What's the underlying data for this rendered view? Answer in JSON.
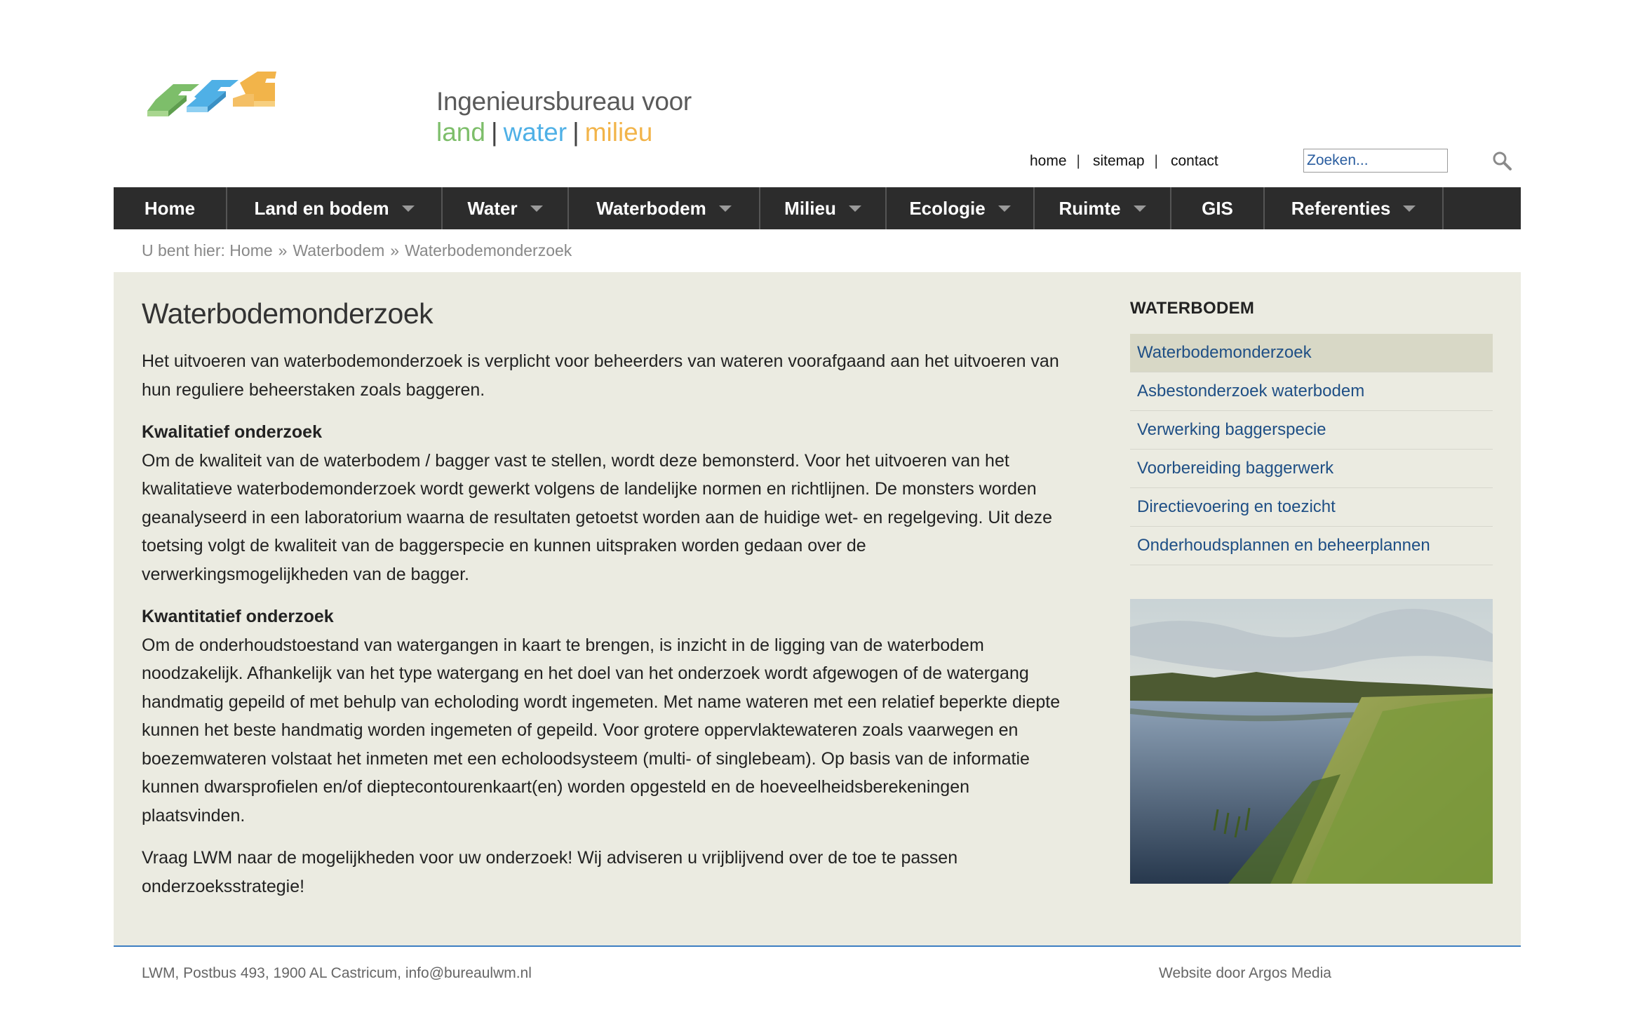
{
  "brand": {
    "title": "Ingenieursbureau voor",
    "sub_land": "land",
    "sub_water": "water",
    "sub_milieu": "milieu",
    "separator": "|",
    "colors": {
      "green": "#7dbe6a",
      "blue": "#4fb0e6",
      "orange": "#f2b44a"
    }
  },
  "topnav": {
    "home": "home",
    "sitemap": "sitemap",
    "contact": "contact",
    "separator": "|"
  },
  "search": {
    "placeholder": "Zoeken...",
    "icon": "search-icon"
  },
  "mainnav": {
    "items": [
      {
        "label": "Home",
        "has_caret": false
      },
      {
        "label": "Land en bodem",
        "has_caret": true
      },
      {
        "label": "Water",
        "has_caret": true
      },
      {
        "label": "Waterbodem",
        "has_caret": true
      },
      {
        "label": "Milieu",
        "has_caret": true
      },
      {
        "label": "Ecologie",
        "has_caret": true
      },
      {
        "label": "Ruimte",
        "has_caret": true
      },
      {
        "label": "GIS",
        "has_caret": false
      },
      {
        "label": "Referenties",
        "has_caret": true
      }
    ]
  },
  "breadcrumb": {
    "prefix": "U bent hier:",
    "items": [
      "Home",
      "Waterbodem",
      "Waterbodemonderzoek"
    ],
    "separator": "»"
  },
  "main": {
    "title": "Waterbodemonderzoek",
    "intro": "Het uitvoeren van waterbodemonderzoek is verplicht voor beheerders van wateren voorafgaand aan het uitvoeren van hun reguliere beheerstaken zoals baggeren.",
    "section1_heading": "Kwalitatief onderzoek",
    "section1_text": "Om de kwaliteit van de waterbodem / bagger vast te stellen, wordt deze bemonsterd. Voor het uitvoeren van het kwalitatieve waterbodemonderzoek wordt gewerkt volgens de landelijke normen en richtlijnen. De monsters worden geanalyseerd in een laboratorium waarna de resultaten getoetst worden aan de huidige wet- en regelgeving. Uit deze toetsing volgt de kwaliteit van de baggerspecie en kunnen uitspraken worden gedaan over de verwerkingsmogelijkheden van de bagger.",
    "section2_heading": "Kwantitatief onderzoek",
    "section2_text": "Om de onderhoudstoestand van watergangen in kaart te brengen, is inzicht in de ligging van de waterbodem noodzakelijk. Afhankelijk van het type watergang en het doel van het onderzoek wordt afgewogen of de watergang handmatig gepeild of met behulp van echoloding wordt ingemeten. Met name wateren met een relatief beperkte diepte kunnen het beste handmatig worden ingemeten of gepeild. Voor grotere oppervlaktewateren zoals vaarwegen en boezemwateren volstaat het inmeten met een echoloodsysteem (multi- of singlebeam). Op basis van de informatie kunnen dwarsprofielen en/of dieptecontourenkaart(en) worden opgesteld en de hoeveelheidsberekeningen plaatsvinden.",
    "closing": "Vraag LWM naar de mogelijkheden voor uw onderzoek! Wij adviseren u vrijblijvend over de toe te passen onderzoeksstrategie!"
  },
  "sidebar": {
    "heading": "WATERBODEM",
    "items": [
      {
        "label": "Waterbodemonderzoek",
        "active": true
      },
      {
        "label": "Asbestonderzoek waterbodem",
        "active": false
      },
      {
        "label": "Verwerking baggerspecie",
        "active": false
      },
      {
        "label": "Voorbereiding baggerwerk",
        "active": false
      },
      {
        "label": "Directievoering en toezicht",
        "active": false
      },
      {
        "label": "Onderhoudsplannen en beheerplannen",
        "active": false
      }
    ]
  },
  "footer": {
    "address": "LWM, Postbus 493, 1900 AL Castricum, info@bureaulwm.nl",
    "credit": "Website door Argos Media"
  }
}
